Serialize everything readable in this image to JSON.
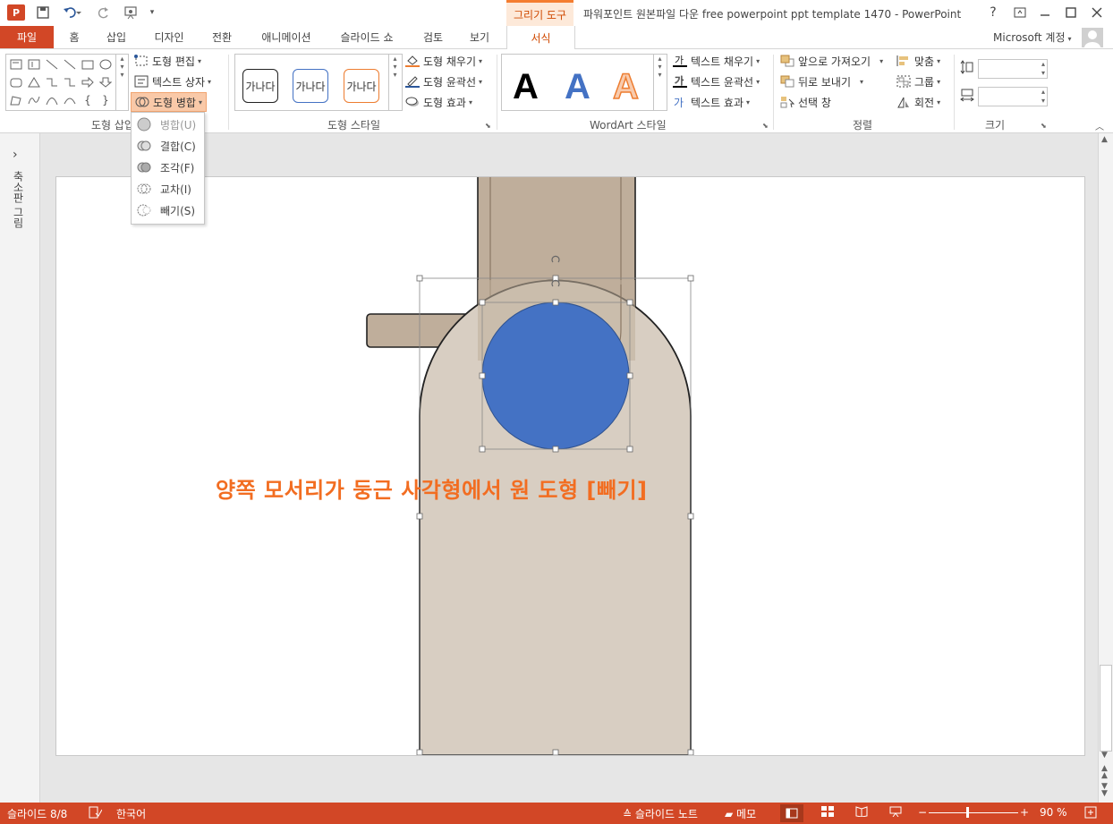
{
  "app": {
    "icon_text": "P",
    "window_title": "파워포인트 원본파일 다운 free powerpoint ppt template 1470 - PowerPoint",
    "context_tab_label": "그리기 도구",
    "account": "Microsoft 계정",
    "help": "?"
  },
  "tabs": [
    "파일",
    "홈",
    "삽입",
    "디자인",
    "전환",
    "애니메이션",
    "슬라이드 쇼",
    "검토",
    "보기",
    "서식"
  ],
  "ribbon": {
    "insert_shapes": {
      "edit_shape": "도형 편집",
      "text_box": "텍스트 상자",
      "merge_shapes": "도형 병합",
      "label": "도형 삽입"
    },
    "shape_styles": {
      "swatch_text": "가나다",
      "fill": "도형 채우기",
      "outline": "도형 윤곽선",
      "effects": "도형 효과",
      "label": "도형 스타일"
    },
    "wordart": {
      "letter": "A",
      "text_fill": "텍스트 채우기",
      "text_outline": "텍스트 윤곽선",
      "text_effects": "텍스트 효과",
      "label": "WordArt 스타일"
    },
    "arrange": {
      "bring_forward": "앞으로 가져오기",
      "send_backward": "뒤로 보내기",
      "selection_pane": "선택 창",
      "align": "맞춤",
      "group": "그룹",
      "rotate": "회전",
      "label": "정렬"
    },
    "size": {
      "label": "크기",
      "height_value": "",
      "width_value": ""
    }
  },
  "merge_menu": {
    "items": [
      {
        "label": "병합(U)"
      },
      {
        "label": "결합(C)"
      },
      {
        "label": "조각(F)"
      },
      {
        "label": "교차(I)"
      },
      {
        "label": "빼기(S)"
      }
    ]
  },
  "thumbnail_pane": {
    "caption": "축소판 그림",
    "expand_glyph": "›"
  },
  "slide": {
    "caption": "양쪽 모서리가 둥근 사각형에서 원 도형 [빼기]",
    "colors": {
      "caption": "#f26d21",
      "circle_fill": "#4472c4",
      "rounded_shape_fill": "#d8cec2",
      "tan_fill": "#bfae9b",
      "tan_dark": "#ab9885"
    }
  },
  "statusbar": {
    "slide_info": "슬라이드 8/8",
    "language": "한국어",
    "notes": "슬라이드 노트",
    "comments": "메모",
    "zoom": "90 %"
  }
}
